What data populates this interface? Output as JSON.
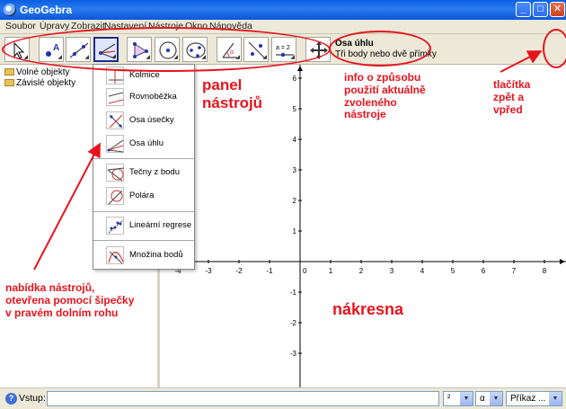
{
  "window": {
    "title": "GeoGebra",
    "controls": [
      "_",
      "□",
      "✕"
    ]
  },
  "menubar": {
    "items": [
      "Soubor",
      "Úpravy",
      "Zobrazit",
      "Nastavení",
      "Nástroje",
      "Okno",
      "Nápověda"
    ]
  },
  "toolbar": {
    "tool_icons": [
      "move-tool-icon",
      "point-tool-icon",
      "line-tool-icon",
      "perpendicular-tool-icon",
      "polygon-tool-icon",
      "circle-tool-icon",
      "conic-tool-icon",
      "angle-tool-icon",
      "reflect-tool-icon",
      "slider-tool-icon",
      "move-view-tool-icon"
    ],
    "slider_label": "a = 2",
    "help": {
      "tool_name": "Osa úhlu",
      "tool_description": "Tři body nebo dvě přímky"
    },
    "undo": "↶",
    "redo": "↷"
  },
  "algebra_view": {
    "items": [
      "Volné objekty",
      "Závislé objekty"
    ]
  },
  "tool_menu": {
    "items": [
      "Kolmice",
      "Rovnoběžka",
      "Osa úsečky",
      "Osa úhlu",
      "Tečny z bodu",
      "Polára",
      "Lineární regrese",
      "Množina bodů"
    ]
  },
  "graphics_view": {
    "x_ticks": [
      "-4",
      "-3",
      "-2",
      "-1",
      "0",
      "1",
      "2",
      "3",
      "4",
      "5",
      "6",
      "7",
      "8"
    ],
    "y_ticks": [
      "6",
      "5",
      "4",
      "3",
      "2",
      "1",
      "0",
      "-1",
      "-2",
      "-3"
    ]
  },
  "annotations": {
    "panel": [
      "panel",
      "nástrojů"
    ],
    "info": [
      "info o způsobu",
      "použití aktuálně",
      "zvoleného",
      "nástroje"
    ],
    "undo_redo": [
      "tlačítka",
      "zpět a",
      "vpřed"
    ],
    "menu": [
      "nabídka nástrojů,",
      "otevřena pomocí šipečky",
      "v pravém dolním rohu"
    ],
    "canvas": "nákresna",
    "color": "#e8141d"
  },
  "input_bar": {
    "help": "?",
    "label": "Vstup:",
    "value": "",
    "combo_symbols": "²",
    "combo_greek": "α",
    "combo_commands": "Příkaz ..."
  }
}
